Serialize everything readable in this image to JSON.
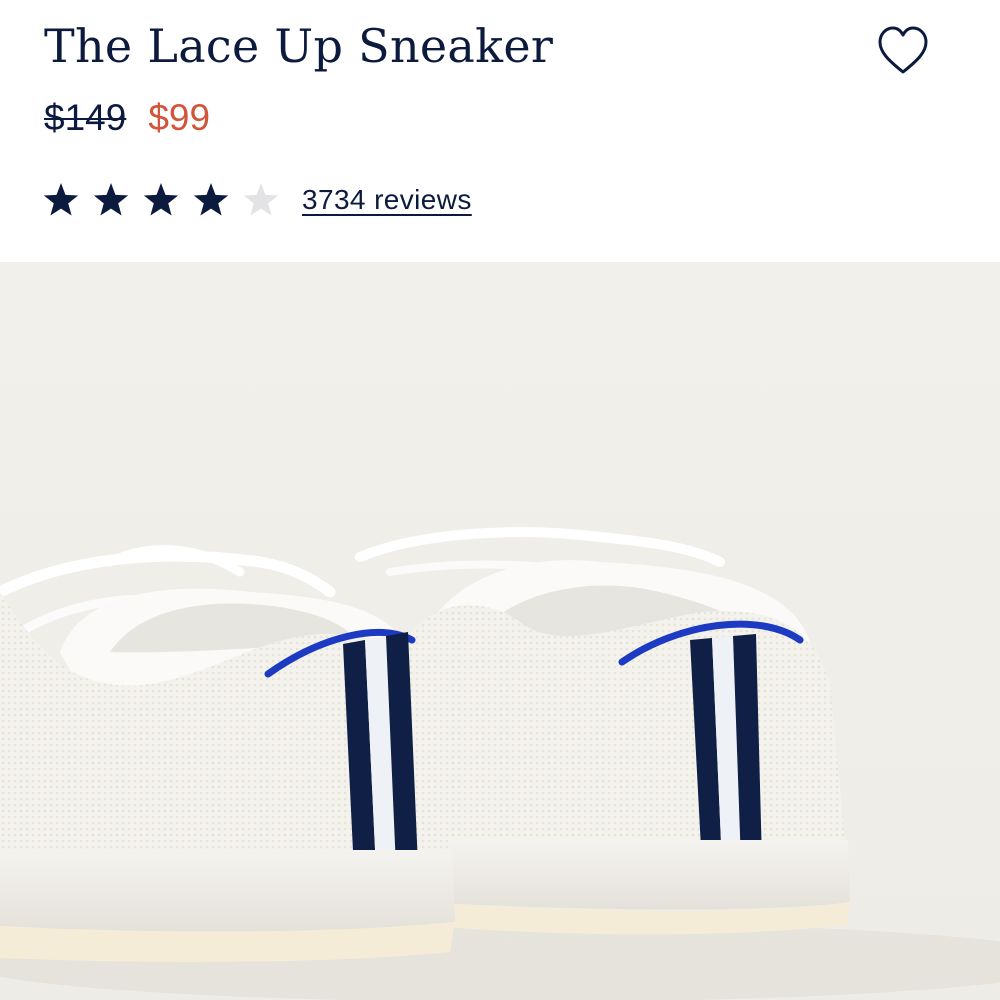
{
  "product": {
    "title": "The Lace Up Sneaker",
    "original_price": "$149",
    "sale_price": "$99",
    "rating": 4,
    "rating_max": 5,
    "reviews_label": "3734 reviews"
  },
  "icons": {
    "favorite": "heart-outline-icon",
    "rating_star": "star-icon"
  },
  "colors": {
    "primary": "#0c1a3e",
    "sale": "#d2543a",
    "star_filled": "#0c1a3e",
    "star_empty": "#e3e3e6",
    "image_background": "#f1efea"
  }
}
